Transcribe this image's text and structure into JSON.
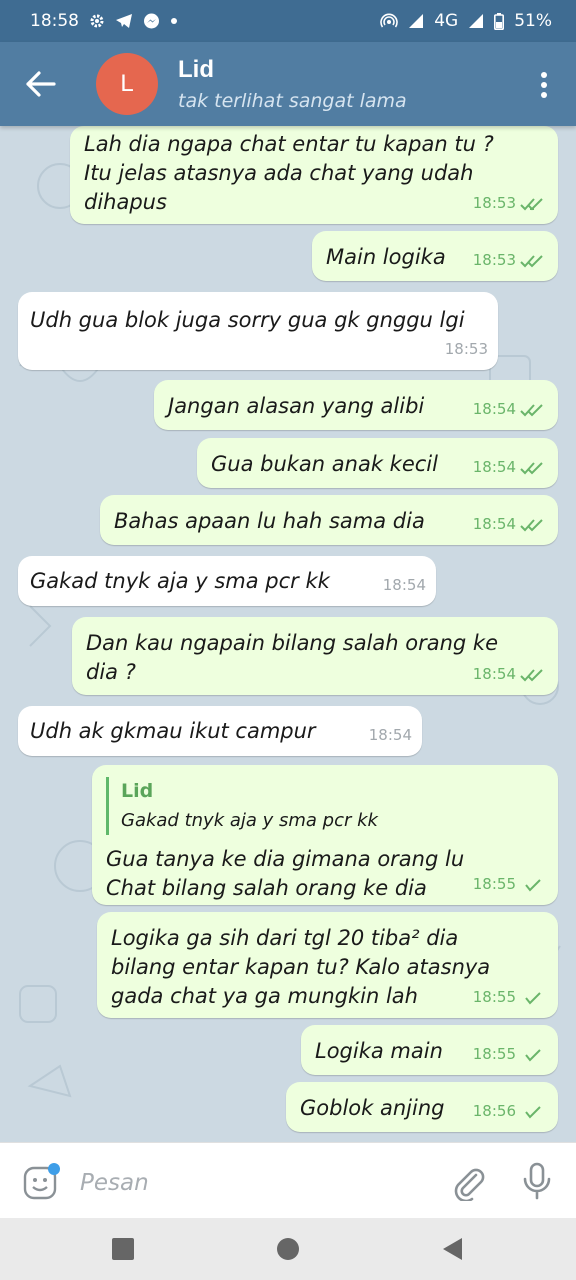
{
  "status_bar": {
    "time": "18:58",
    "network": "4G",
    "battery": "51%",
    "left_icons": [
      "gear-icon",
      "telegram-icon",
      "messenger-icon",
      "dot-icon"
    ],
    "right_icons": [
      "hotspot-icon",
      "signal-icon",
      "battery-icon"
    ]
  },
  "header": {
    "avatar_letter": "L",
    "avatar_color": "#e5674f",
    "title": "Lid",
    "subtitle": "tak terlihat sangat lama",
    "bar_color": "#517da2"
  },
  "messages": [
    {
      "dir": "out",
      "text": "Lah dia ngapa chat entar tu kapan tu ? Itu jelas atasnya ada chat yang udah dihapus",
      "time": "18:53",
      "status": "read"
    },
    {
      "dir": "out",
      "text": "Main logika",
      "time": "18:53",
      "status": "read"
    },
    {
      "dir": "in",
      "text": "Udh gua blok juga sorry gua gk gnggu lgi",
      "time": "18:53"
    },
    {
      "dir": "out",
      "text": "Jangan alasan yang alibi",
      "time": "18:54",
      "status": "read"
    },
    {
      "dir": "out",
      "text": "Gua bukan anak kecil",
      "time": "18:54",
      "status": "read"
    },
    {
      "dir": "out",
      "text": "Bahas apaan lu hah sama dia",
      "time": "18:54",
      "status": "read"
    },
    {
      "dir": "in",
      "text": "Gakad tnyk aja y sma pcr kk",
      "time": "18:54"
    },
    {
      "dir": "out",
      "text": "Dan kau ngapain bilang salah orang ke dia ?",
      "time": "18:54",
      "status": "read"
    },
    {
      "dir": "in",
      "text": "Udh ak gkmau ikut campur",
      "time": "18:54"
    },
    {
      "dir": "out",
      "reply_name": "Lid",
      "reply_text": "Gakad tnyk aja y sma pcr kk",
      "text": "Gua tanya ke dia gimana orang lu Chat bilang salah orang ke dia",
      "time": "18:55",
      "status": "sent"
    },
    {
      "dir": "out",
      "text": "Logika ga sih dari tgl 20 tiba² dia bilang entar kapan tu? Kalo atasnya gada chat ya ga mungkin lah",
      "time": "18:55",
      "status": "sent"
    },
    {
      "dir": "out",
      "text": "Logika main",
      "time": "18:55",
      "status": "sent"
    },
    {
      "dir": "out",
      "text": "Goblok anjing",
      "time": "18:56",
      "status": "sent"
    }
  ],
  "composer": {
    "placeholder": "Pesan",
    "emoji_icon": "sticker-icon",
    "attach_icon": "paperclip-icon",
    "mic_icon": "microphone-icon"
  },
  "colors": {
    "outgoing_bubble": "#eeffde",
    "incoming_bubble": "#ffffff",
    "check_color": "#6ab56a",
    "chat_background": "#ccd9e2"
  }
}
